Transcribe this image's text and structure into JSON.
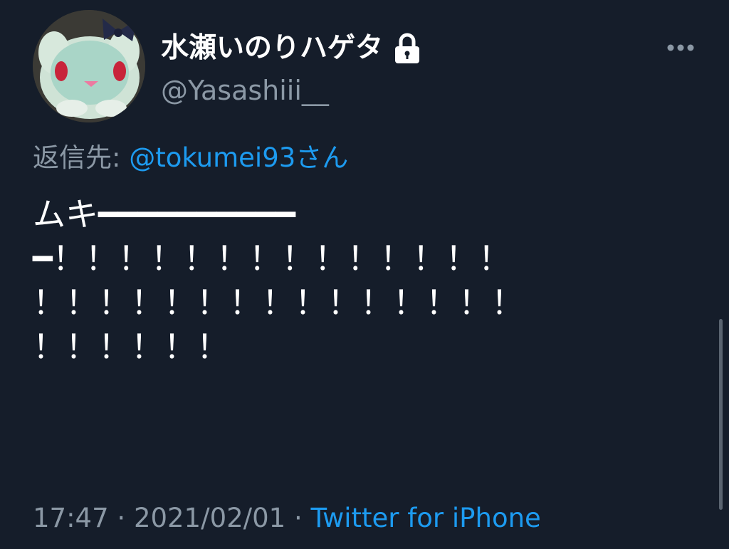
{
  "user": {
    "display_name": "水瀬いのりハゲタ",
    "handle": "@Yasashiii__",
    "avatar_icon": "plush-bunny-avatar",
    "locked_icon": "lock-icon"
  },
  "reply": {
    "prefix": "返信先: ",
    "target": "@tokumei93さん"
  },
  "tweet": {
    "lines": [
      "ムキ━━━━━━━━━━",
      "━！！！！！！！！！！！！！！",
      "！！！！！！！！！！！！！！！",
      "！！！！！！"
    ]
  },
  "meta": {
    "time": "17:47",
    "separator": " · ",
    "date": "2021/02/01",
    "source": "Twitter for iPhone"
  },
  "colors": {
    "background": "#151d2a",
    "primary_text": "#ffffff",
    "secondary_text": "#8b98a5",
    "link": "#1d9bf0"
  }
}
